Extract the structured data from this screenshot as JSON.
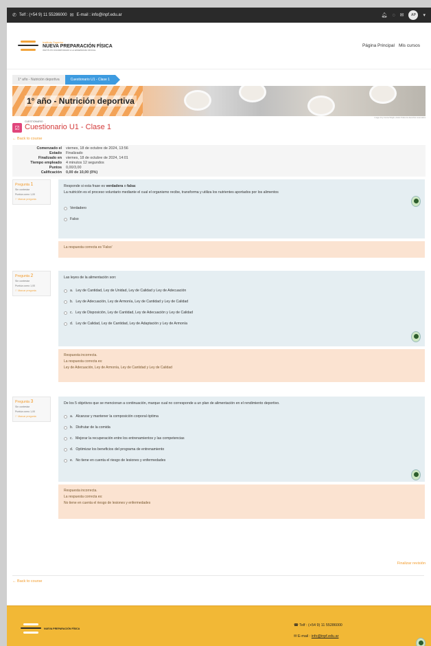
{
  "topbar": {
    "phone": "Telf : (+54 9) 11 55286000",
    "email": "E-mail : info@inpf.edu.ar",
    "avatar": "AP"
  },
  "header": {
    "logo_small": "Instituto Superior",
    "logo_big": "NUEVA PREPARACIÓN FÍSICA",
    "logo_tiny": "INSTITUTO INCORPORADO A LA ENSEÑANZA OFICIAL",
    "nav_home": "Página Principal",
    "nav_courses": "Mis cursos"
  },
  "breadcrumb": {
    "course": "1° año - Nutrición deportiva",
    "current": "Cuestionario U1 - Clase 1"
  },
  "banner": {
    "title": "1° año - Nutrición deportiva",
    "credit": "Image 4 by Conna Wright, Aceite Todos los derechos reservados"
  },
  "quiz": {
    "kind": "CUESTIONARIO",
    "title": "Cuestionario U1 - Clase 1",
    "back": "Back to course"
  },
  "summary": [
    {
      "label": "Comenzado el",
      "value": "viernes, 18 de octubre de 2024, 13:56"
    },
    {
      "label": "Estado",
      "value": "Finalizado"
    },
    {
      "label": "Finalizado en",
      "value": "viernes, 18 de octubre de 2024, 14:01"
    },
    {
      "label": "Tiempo empleado",
      "value": "4 minutos 12 segundos"
    },
    {
      "label": "Puntos",
      "value": "0,00/3,00"
    },
    {
      "label": "Calificación",
      "value": "0,00 de 10,00 (0%)"
    }
  ],
  "questions": [
    {
      "number": "1",
      "label": "Pregunta",
      "status": "Sin contestar",
      "score": "Puntúa como 1,00",
      "flag": "Marcar pregunta",
      "prompt_lead": "Responde si esta frase es",
      "prompt_true": "verdadera",
      "prompt_or": "o",
      "prompt_false": "falsa",
      "statement": "La nutrición es el proceso voluntario mediante el cual el organismo recibe, transforma y utiliza los nutrientes aportados por los alimentos",
      "options": [
        "Verdadero",
        "Falso"
      ],
      "feedback_title": "",
      "feedback_line": "La respuesta correcta es 'Falso'",
      "feedback_answer": ""
    },
    {
      "number": "2",
      "label": "Pregunta",
      "status": "Sin contestar",
      "score": "Puntúa como 1,00",
      "flag": "Marcar pregunta",
      "statement": "Las leyes de la alimentación son:",
      "options": [
        {
          "letter": "a.",
          "text": "Ley de Cantidad, Ley de Unidad, Ley de Calidad y Ley de Adecuación"
        },
        {
          "letter": "b.",
          "text": "Ley de Adecuación, Ley de Armonía, Ley de Cantidad y Ley de Calidad"
        },
        {
          "letter": "c.",
          "text": "Ley de Disposición, Ley de Cantidad, Ley de Adecuación y Ley de Calidad"
        },
        {
          "letter": "d.",
          "text": "Ley de Calidad, Ley de Cantidad, Ley de Adaptación y Ley de Armonía"
        }
      ],
      "feedback_title": "Respuesta incorrecta.",
      "feedback_line": "La respuesta correcta es:",
      "feedback_answer": "Ley de Adecuación, Ley de Armonía, Ley de Cantidad y Ley de Calidad"
    },
    {
      "number": "3",
      "label": "Pregunta",
      "status": "Sin contestar",
      "score": "Puntúa como 1,00",
      "flag": "Marcar pregunta",
      "statement": "De los 5 objetivos que se mencionan a continuación, marque cual no corresponde a un plan de alimentación en el rendimiento deportivo.",
      "options": [
        {
          "letter": "a.",
          "text": "Alcanzar y mantener la composición corporal óptima"
        },
        {
          "letter": "b.",
          "text": "Disfrutar de la comida"
        },
        {
          "letter": "c.",
          "text": "Mejorar la recuperación entre los entrenamientos y las competencias"
        },
        {
          "letter": "d.",
          "text": "Optimizar los beneficios del programa de entrenamiento"
        },
        {
          "letter": "e.",
          "text": "No tiene en cuenta el riesgo de lesiones y enfermedades"
        }
      ],
      "feedback_title": "Respuesta incorrecta.",
      "feedback_line": "La respuesta correcta es:",
      "feedback_answer": "No tiene en cuenta el riesgo de lesiones y enfermedades"
    }
  ],
  "finish": "Finalizar revisión",
  "footer": {
    "logo_text": "NUEVA PREPARACIÓN FÍSICA",
    "phone": "Telf : (+54 9) 11 55286000",
    "email_label": "E-mail :",
    "email": "info@inpf.edu.ar"
  },
  "colors": {
    "accent": "#f29b2b",
    "title_red": "#d33a3a",
    "crumb_blue": "#3d9be0",
    "footer": "#f2b836"
  }
}
